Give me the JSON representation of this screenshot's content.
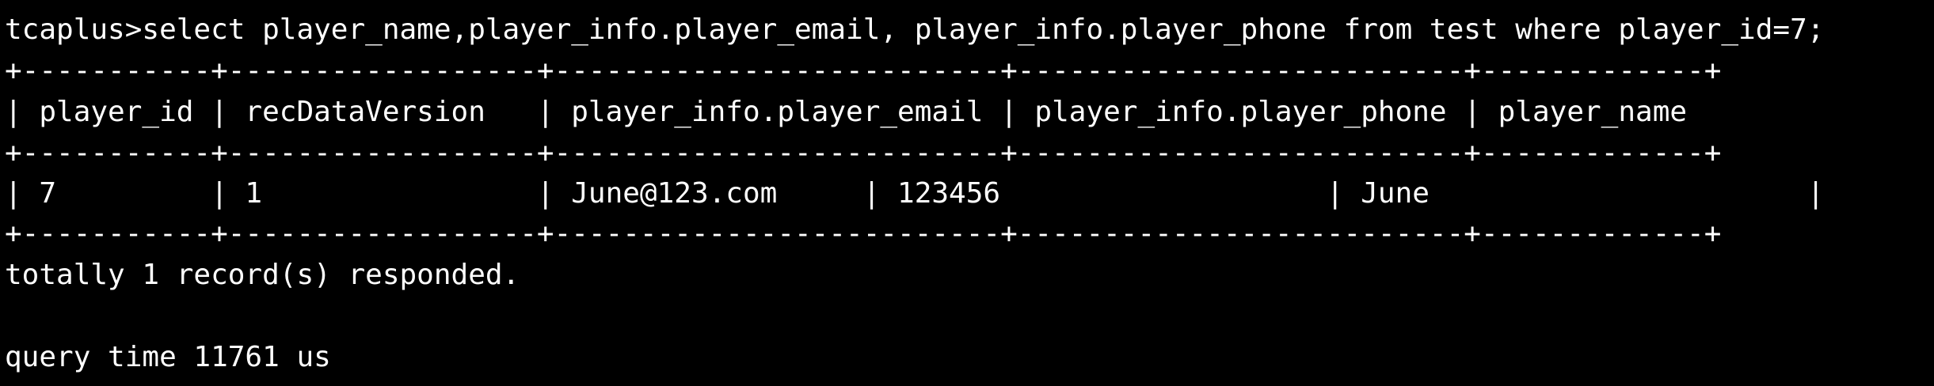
{
  "terminal": {
    "command_line": "tcaplus>select player_name,player_info.player_email, player_info.player_phone from test where player_id=7;",
    "border_top": "+-----------+------------------+--------------------------+--------------------------+-------------+",
    "header_row": "| player_id | recDataVersion   | player_info.player_email | player_info.player_phone | player_name",
    "border_mid": "+-----------+------------------+--------------------------+--------------------------+-------------+",
    "data_row": "| 7         | 1                | June@123.com     | 123456                   | June                      |",
    "border_bottom": "+-----------+------------------+--------------------------+--------------------------+-------------+",
    "summary": "totally 1 record(s) responded.",
    "query_time": "query time 11761 us"
  },
  "colors": {
    "background": "#000000",
    "text": "#ffffff"
  }
}
